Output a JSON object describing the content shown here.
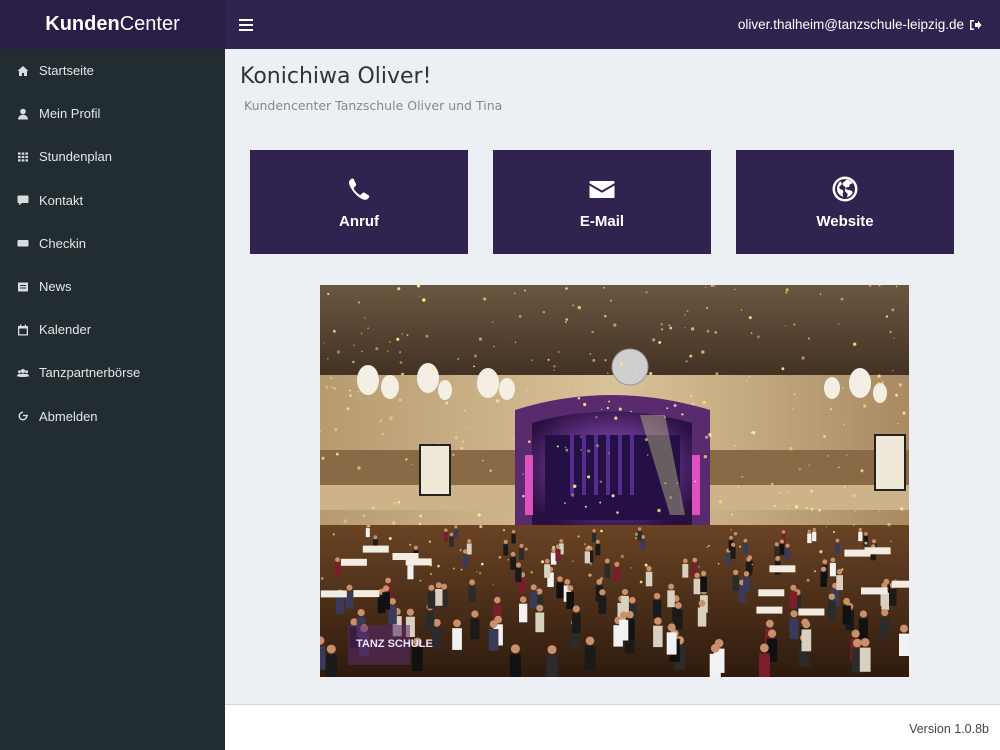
{
  "header": {
    "logo_bold": "Kunden",
    "logo_light": "Center",
    "user_email": "oliver.thalheim@tanzschule-leipzig.de",
    "menu_icon": "bars-icon",
    "logout_icon": "sign-out-icon"
  },
  "sidebar": {
    "items": [
      {
        "label": "Startseite",
        "icon": "home-icon"
      },
      {
        "label": "Mein Profil",
        "icon": "user-icon"
      },
      {
        "label": "Stundenplan",
        "icon": "grid-icon"
      },
      {
        "label": "Kontakt",
        "icon": "comment-icon"
      },
      {
        "label": "Checkin",
        "icon": "keyboard-icon"
      },
      {
        "label": "News",
        "icon": "newspaper-icon"
      },
      {
        "label": "Kalender",
        "icon": "calendar-icon"
      },
      {
        "label": "Tanzpartnerbörse",
        "icon": "users-icon"
      },
      {
        "label": "Abmelden",
        "icon": "power-off-icon"
      }
    ]
  },
  "main": {
    "title": "Konichiwa Oliver!",
    "subtitle": "Kundencenter Tanzschule Oliver und Tina",
    "tiles": [
      {
        "label": "Anruf",
        "icon": "phone-icon"
      },
      {
        "label": "E-Mail",
        "icon": "envelope-icon"
      },
      {
        "label": "Website",
        "icon": "globe-icon"
      }
    ],
    "hero_logo_text": "TANZ SCHULE"
  },
  "footer": {
    "version": "Version 1.0.8b"
  },
  "colors": {
    "header": "#31234f",
    "logo_bg": "#2a1e46",
    "sidebar": "#222d32",
    "tile": "#31234f",
    "content_bg": "#ecf0f5"
  }
}
